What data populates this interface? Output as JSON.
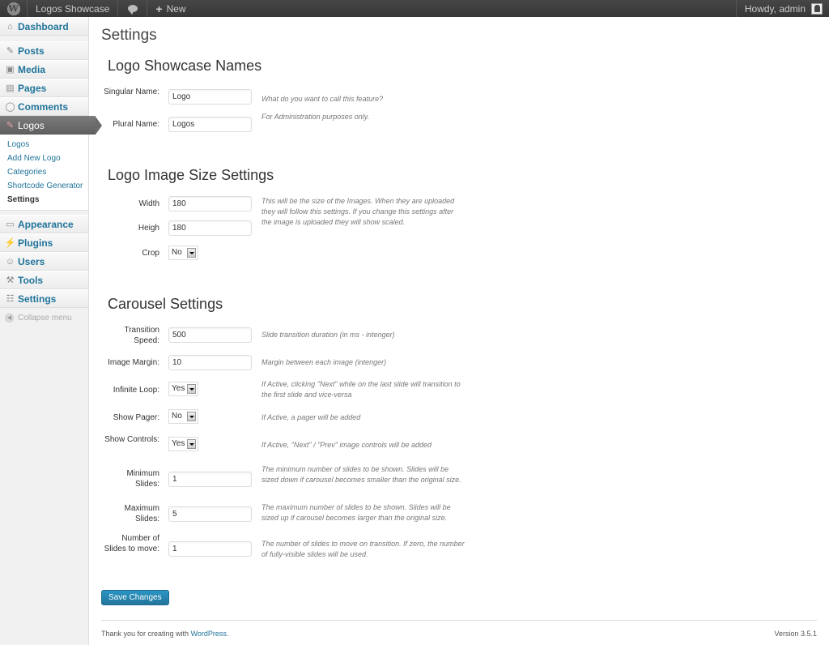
{
  "adminbar": {
    "site_name": "Logos Showcase",
    "new_label": "New",
    "howdy": "Howdy, admin",
    "icons": {
      "wp_logo": "wordpress-logo-icon",
      "comments": "comment-bubble-icon",
      "new": "plus-icon",
      "avatar": "avatar-icon"
    }
  },
  "sidebar": {
    "items": [
      {
        "label": "Dashboard",
        "icon": "home-icon"
      },
      {
        "label": "Posts",
        "icon": "pushpin-icon"
      },
      {
        "label": "Media",
        "icon": "media-icon"
      },
      {
        "label": "Pages",
        "icon": "pages-icon"
      },
      {
        "label": "Comments",
        "icon": "comment-icon"
      },
      {
        "label": "Logos",
        "icon": "pushpin-icon"
      },
      {
        "label": "Appearance",
        "icon": "appearance-icon"
      },
      {
        "label": "Plugins",
        "icon": "plugin-icon"
      },
      {
        "label": "Users",
        "icon": "users-icon"
      },
      {
        "label": "Tools",
        "icon": "tools-icon"
      },
      {
        "label": "Settings",
        "icon": "settings-icon"
      }
    ],
    "submenu": [
      "Logos",
      "Add New Logo",
      "Categories",
      "Shortcode Generator",
      "Settings"
    ],
    "collapse": "Collapse menu"
  },
  "page": {
    "title": "Settings",
    "sections": {
      "names": {
        "title": "Logo Showcase Names",
        "singular": {
          "label": "Singular Name:",
          "value": "Logo",
          "desc": "What do you want to call this feature?"
        },
        "plural": {
          "label": "Plural Name:",
          "value": "Logos",
          "desc": "For Administration purposes only."
        }
      },
      "image_size": {
        "title": "Logo Image Size Settings",
        "width": {
          "label": "Width",
          "value": "180"
        },
        "height": {
          "label": "Heigh",
          "value": "180"
        },
        "crop": {
          "label": "Crop",
          "value": "No"
        },
        "desc": "This will be the size of the Images. When they are uploaded they will follow this settings. If you change this settings after the image is uploaded they will show scaled."
      },
      "carousel": {
        "title": "Carousel Settings",
        "transition_speed": {
          "label": "Transition Speed:",
          "value": "500",
          "desc": "Slide transition duration (in ms - intenger)"
        },
        "image_margin": {
          "label": "Image Margin:",
          "value": "10",
          "desc": "Margin between each image (intenger)"
        },
        "infinite_loop": {
          "label": "Infinite Loop:",
          "value": "Yes",
          "desc": "If Active, clicking \"Next\" while on the last slide will transition to the first slide and vice-versa"
        },
        "show_pager": {
          "label": "Show Pager:",
          "value": "No",
          "desc": "If Active, a pager will be added"
        },
        "show_controls": {
          "label": "Show Controls:",
          "value": "Yes",
          "desc": "If Active, \"Next\" / \"Prev\" image controls will be added"
        },
        "min_slides": {
          "label": "Minimum Slides:",
          "value": "1",
          "desc": "The minimum number of slides to be shown. Slides will be sized down if carousel becomes smaller than the original size."
        },
        "max_slides": {
          "label": "Maximum Slides:",
          "value": "5",
          "desc": "The maximum number of slides to be shown. Slides will be sized up if carousel becomes larger than the original size."
        },
        "move_slides": {
          "label": "Number of Slides to move:",
          "value": "1",
          "desc": "The number of slides to move on transition. If zero, the number of fully-visible slides will be used."
        }
      }
    },
    "save_label": "Save Changes"
  },
  "footer": {
    "thanks_prefix": "Thank you for creating with ",
    "thanks_link": "WordPress",
    "thanks_suffix": ".",
    "version": "Version 3.5.1"
  },
  "colors": {
    "link": "#21759b",
    "adminbar": "#464646",
    "button": "#21759b"
  }
}
